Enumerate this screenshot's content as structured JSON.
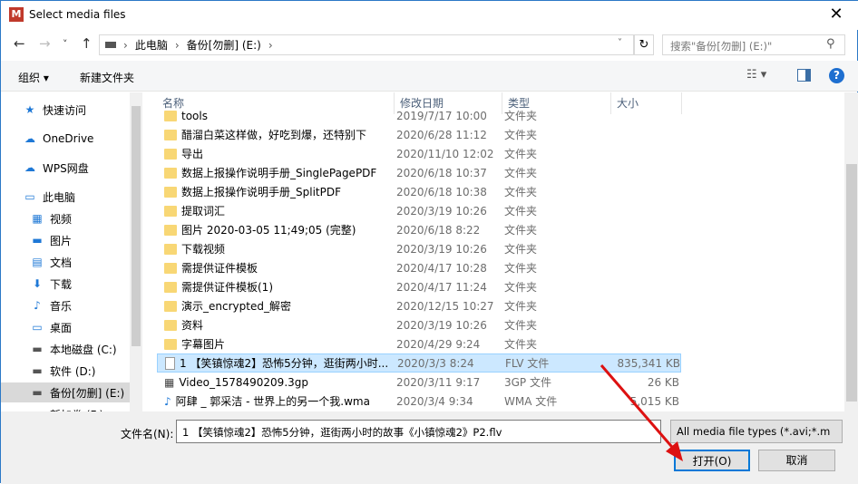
{
  "window": {
    "title": "Select media files",
    "app_icon": "M",
    "close": "✕"
  },
  "nav": {
    "back": "←",
    "forward": "→",
    "recent": "˅",
    "up": "↑",
    "breadcrumb": [
      "此电脑",
      "备份[勿删] (E:)"
    ],
    "search_placeholder": "搜索\"备份[勿删] (E:)\""
  },
  "toolbar": {
    "organize": "组织 ▾",
    "new_folder": "新建文件夹"
  },
  "sidebar": {
    "items": [
      {
        "label": "快速访问",
        "icon": "star-icon"
      },
      {
        "label": "OneDrive",
        "icon": "cloud-icon"
      },
      {
        "label": "WPS网盘",
        "icon": "cloud-icon"
      },
      {
        "label": "此电脑",
        "icon": "computer-icon"
      },
      {
        "label": "视频",
        "icon": "video-icon"
      },
      {
        "label": "图片",
        "icon": "picture-icon"
      },
      {
        "label": "文档",
        "icon": "document-icon"
      },
      {
        "label": "下载",
        "icon": "download-icon"
      },
      {
        "label": "音乐",
        "icon": "music-icon"
      },
      {
        "label": "桌面",
        "icon": "desktop-icon"
      },
      {
        "label": "本地磁盘 (C:)",
        "icon": "drive-icon"
      },
      {
        "label": "软件 (D:)",
        "icon": "drive-icon"
      },
      {
        "label": "备份[勿删] (E:)",
        "icon": "drive-icon",
        "selected": true
      },
      {
        "label": "新加卷 (F:)",
        "icon": "drive-icon"
      }
    ]
  },
  "columns": [
    "名称",
    "修改日期",
    "类型",
    "大小"
  ],
  "files": [
    {
      "name": "tools",
      "date": "2019/7/17 10:00",
      "type": "文件夹",
      "size": "",
      "kind": "folder"
    },
    {
      "name": "醋溜白菜这样做，好吃到爆，还特别下",
      "date": "2020/6/28 11:12",
      "type": "文件夹",
      "size": "",
      "kind": "folder"
    },
    {
      "name": "导出",
      "date": "2020/11/10 12:02",
      "type": "文件夹",
      "size": "",
      "kind": "folder"
    },
    {
      "name": "数据上报操作说明手册_SinglePagePDF",
      "date": "2020/6/18 10:37",
      "type": "文件夹",
      "size": "",
      "kind": "folder"
    },
    {
      "name": "数据上报操作说明手册_SplitPDF",
      "date": "2020/6/18 10:38",
      "type": "文件夹",
      "size": "",
      "kind": "folder"
    },
    {
      "name": "提取词汇",
      "date": "2020/3/19 10:26",
      "type": "文件夹",
      "size": "",
      "kind": "folder"
    },
    {
      "name": "图片 2020-03-05 11;49;05 (完整)",
      "date": "2020/6/18 8:22",
      "type": "文件夹",
      "size": "",
      "kind": "folder"
    },
    {
      "name": "下载视频",
      "date": "2020/3/19 10:26",
      "type": "文件夹",
      "size": "",
      "kind": "folder"
    },
    {
      "name": "需提供证件模板",
      "date": "2020/4/17 10:28",
      "type": "文件夹",
      "size": "",
      "kind": "folder"
    },
    {
      "name": "需提供证件模板(1)",
      "date": "2020/4/17 11:24",
      "type": "文件夹",
      "size": "",
      "kind": "folder"
    },
    {
      "name": "演示_encrypted_解密",
      "date": "2020/12/15 10:27",
      "type": "文件夹",
      "size": "",
      "kind": "folder"
    },
    {
      "name": "资料",
      "date": "2020/3/19 10:26",
      "type": "文件夹",
      "size": "",
      "kind": "folder"
    },
    {
      "name": "字幕图片",
      "date": "2020/4/29 9:24",
      "type": "文件夹",
      "size": "",
      "kind": "folder"
    },
    {
      "name": "1 【笑镇惊魂2】恐怖5分钟，逛街两小时...",
      "date": "2020/3/3 8:24",
      "type": "FLV 文件",
      "size": "835,341 KB",
      "kind": "file",
      "selected": true
    },
    {
      "name": "Video_1578490209.3gp",
      "date": "2020/3/11 9:17",
      "type": "3GP 文件",
      "size": "26 KB",
      "kind": "video"
    },
    {
      "name": "阿肆 _ 郭采洁 - 世界上的另一个我.wma",
      "date": "2020/3/4 9:34",
      "type": "WMA 文件",
      "size": "5,015 KB",
      "kind": "audio"
    }
  ],
  "footer": {
    "filename_label": "文件名(N):",
    "filename_value": "1 【笑镇惊魂2】恐怖5分钟，逛街两小时的故事《小镇惊魂2》P2.flv",
    "filter": "All media file types (*.avi;*.m",
    "open": "打开(O)",
    "cancel": "取消"
  }
}
